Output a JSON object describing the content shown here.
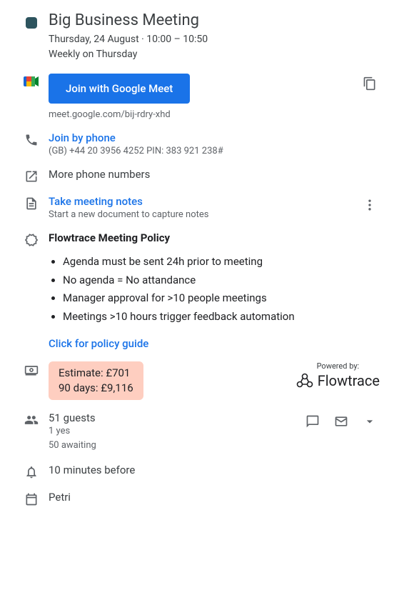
{
  "event": {
    "title": "Big Business Meeting",
    "date_line": "Thursday, 24 August  ·  10:00 – 10:50",
    "recurrence": "Weekly on Thursday"
  },
  "meet": {
    "join_label": "Join with Google Meet",
    "link": "meet.google.com/bij-rdry-xhd"
  },
  "phone": {
    "join_label": "Join by phone",
    "details": "(GB) +44 20 3956 4252 PIN: 383 921 238#",
    "more_label": "More phone numbers"
  },
  "notes": {
    "take_label": "Take meeting notes",
    "sub_label": "Start a new document to capture notes"
  },
  "policy": {
    "title": "Flowtrace Meeting Policy",
    "items": [
      "Agenda must be sent 24h prior to meeting",
      "No agenda = No attandance",
      "Manager approval for >10 people meetings",
      "Meetings >10 hours trigger feedback automation"
    ],
    "guide_link": "Click for policy guide"
  },
  "estimate": {
    "line1": "Estimate: £701",
    "line2": "90 days: £9,116"
  },
  "powered": {
    "label": "Powered by:",
    "brand": "Flowtrace"
  },
  "guests": {
    "count_label": "51 guests",
    "yes": "1 yes",
    "awaiting": "50 awaiting"
  },
  "reminder": {
    "label": "10 minutes before"
  },
  "owner": {
    "name": "Petri"
  }
}
